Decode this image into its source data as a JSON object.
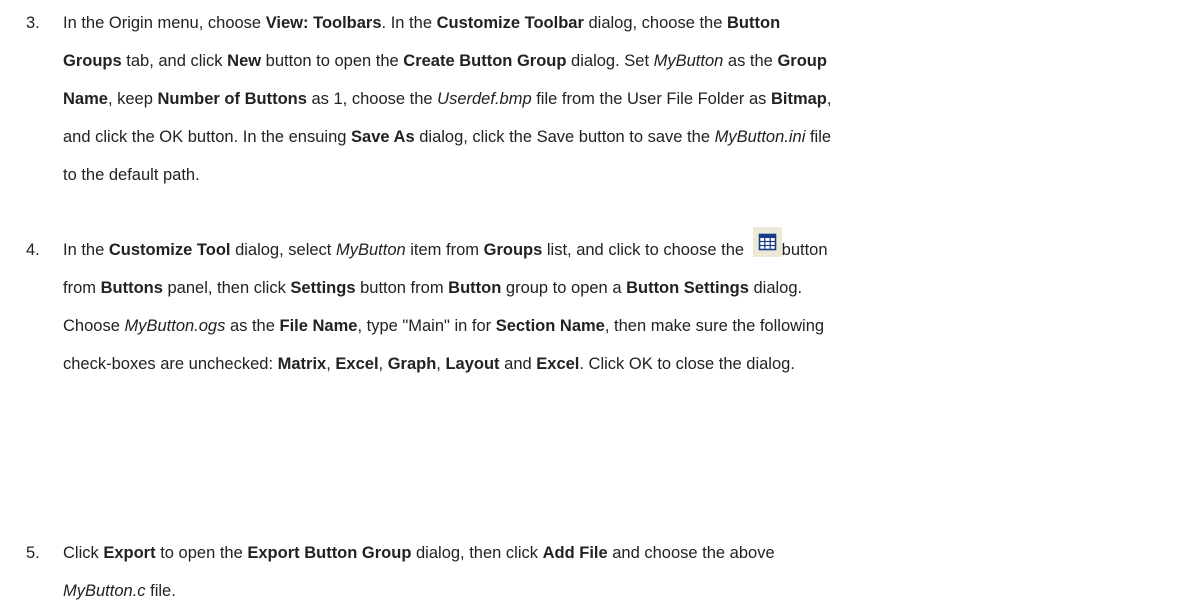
{
  "steps": [
    {
      "number": "3.",
      "lines": [
        [
          {
            "t": "In the Origin menu, choose "
          },
          {
            "t": "View: Toolbars",
            "b": true
          },
          {
            "t": ". In the "
          },
          {
            "t": "Customize Toolbar",
            "b": true
          },
          {
            "t": " dialog, choose the "
          },
          {
            "t": "Button",
            "b": true
          }
        ],
        [
          {
            "t": "Groups",
            "b": true
          },
          {
            "t": " tab, and click "
          },
          {
            "t": "New",
            "b": true
          },
          {
            "t": " button to open the "
          },
          {
            "t": "Create Button Group",
            "b": true
          },
          {
            "t": " dialog. Set "
          },
          {
            "t": "MyButton",
            "i": true
          },
          {
            "t": " as the "
          },
          {
            "t": "Group",
            "b": true
          }
        ],
        [
          {
            "t": "Name",
            "b": true
          },
          {
            "t": ", keep "
          },
          {
            "t": "Number of Buttons",
            "b": true
          },
          {
            "t": " as 1, choose the "
          },
          {
            "t": "Userdef.bmp",
            "i": true
          },
          {
            "t": " file from the User File Folder as "
          },
          {
            "t": "Bitmap",
            "b": true
          },
          {
            "t": ","
          }
        ],
        [
          {
            "t": "and click the OK button. In the ensuing "
          },
          {
            "t": "Save As",
            "b": true
          },
          {
            "t": " dialog, click the Save button to save the "
          },
          {
            "t": "MyButton.ini",
            "i": true
          },
          {
            "t": " file"
          }
        ],
        [
          {
            "t": "to the default path."
          }
        ]
      ]
    },
    {
      "number": "4.",
      "lines": [
        [
          {
            "t": "In the "
          },
          {
            "t": "Customize Tool",
            "b": true
          },
          {
            "t": " dialog, select "
          },
          {
            "t": "MyButton",
            "i": true
          },
          {
            "t": " item from "
          },
          {
            "t": "Groups",
            "b": true
          },
          {
            "t": " list, and click to choose the "
          },
          {
            "icon": "table-grid-icon"
          },
          {
            "t": "button"
          }
        ],
        [
          {
            "t": "from "
          },
          {
            "t": "Buttons",
            "b": true
          },
          {
            "t": " panel, then click "
          },
          {
            "t": "Settings",
            "b": true
          },
          {
            "t": " button from "
          },
          {
            "t": "Button",
            "b": true
          },
          {
            "t": " group to open a "
          },
          {
            "t": "Button Settings",
            "b": true
          },
          {
            "t": " dialog."
          }
        ],
        [
          {
            "t": "Choose "
          },
          {
            "t": "MyButton.ogs",
            "i": true
          },
          {
            "t": " as the "
          },
          {
            "t": "File Name",
            "b": true
          },
          {
            "t": ", type \"Main\" in for "
          },
          {
            "t": "Section Name",
            "b": true
          },
          {
            "t": ", then make sure the following"
          }
        ],
        [
          {
            "t": "check-boxes are unchecked: "
          },
          {
            "t": "Matrix",
            "b": true
          },
          {
            "t": ", "
          },
          {
            "t": "Excel",
            "b": true
          },
          {
            "t": ", "
          },
          {
            "t": "Graph",
            "b": true
          },
          {
            "t": ", "
          },
          {
            "t": "Layout",
            "b": true
          },
          {
            "t": " and "
          },
          {
            "t": "Excel",
            "b": true
          },
          {
            "t": ". Click OK to close the dialog."
          }
        ]
      ]
    },
    {
      "number": "5.",
      "lines": [
        [
          {
            "t": "Click "
          },
          {
            "t": "Export",
            "b": true
          },
          {
            "t": " to open the "
          },
          {
            "t": "Export Button Group",
            "b": true
          },
          {
            "t": " dialog, then click "
          },
          {
            "t": "Add File",
            "b": true
          },
          {
            "t": " and choose the above"
          }
        ],
        [
          {
            "t": "MyButton.c",
            "i": true
          },
          {
            "t": " file."
          }
        ]
      ]
    }
  ],
  "icon_colors": {
    "background": "#ecead6",
    "grid": "#1a3a8c",
    "cell": "#ffffff"
  }
}
